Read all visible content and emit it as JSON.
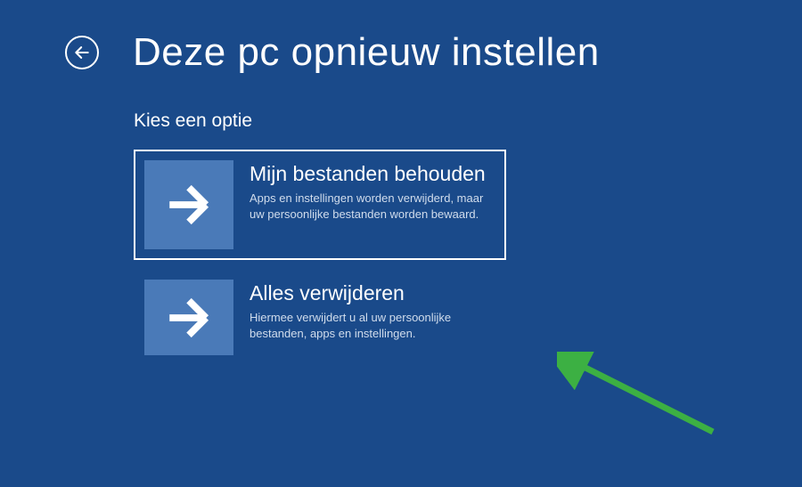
{
  "header": {
    "title": "Deze pc opnieuw instellen"
  },
  "subtitle": "Kies een optie",
  "options": [
    {
      "title": "Mijn bestanden behouden",
      "description": "Apps en instellingen worden verwijderd, maar uw persoonlijke bestanden worden bewaard.",
      "selected": true
    },
    {
      "title": "Alles verwijderen",
      "description": "Hiermee verwijdert u al uw persoonlijke bestanden, apps en instellingen.",
      "selected": false
    }
  ],
  "colors": {
    "background": "#1a4a8a",
    "tile": "#4a7ab8",
    "annotation_arrow": "#3cb043"
  }
}
